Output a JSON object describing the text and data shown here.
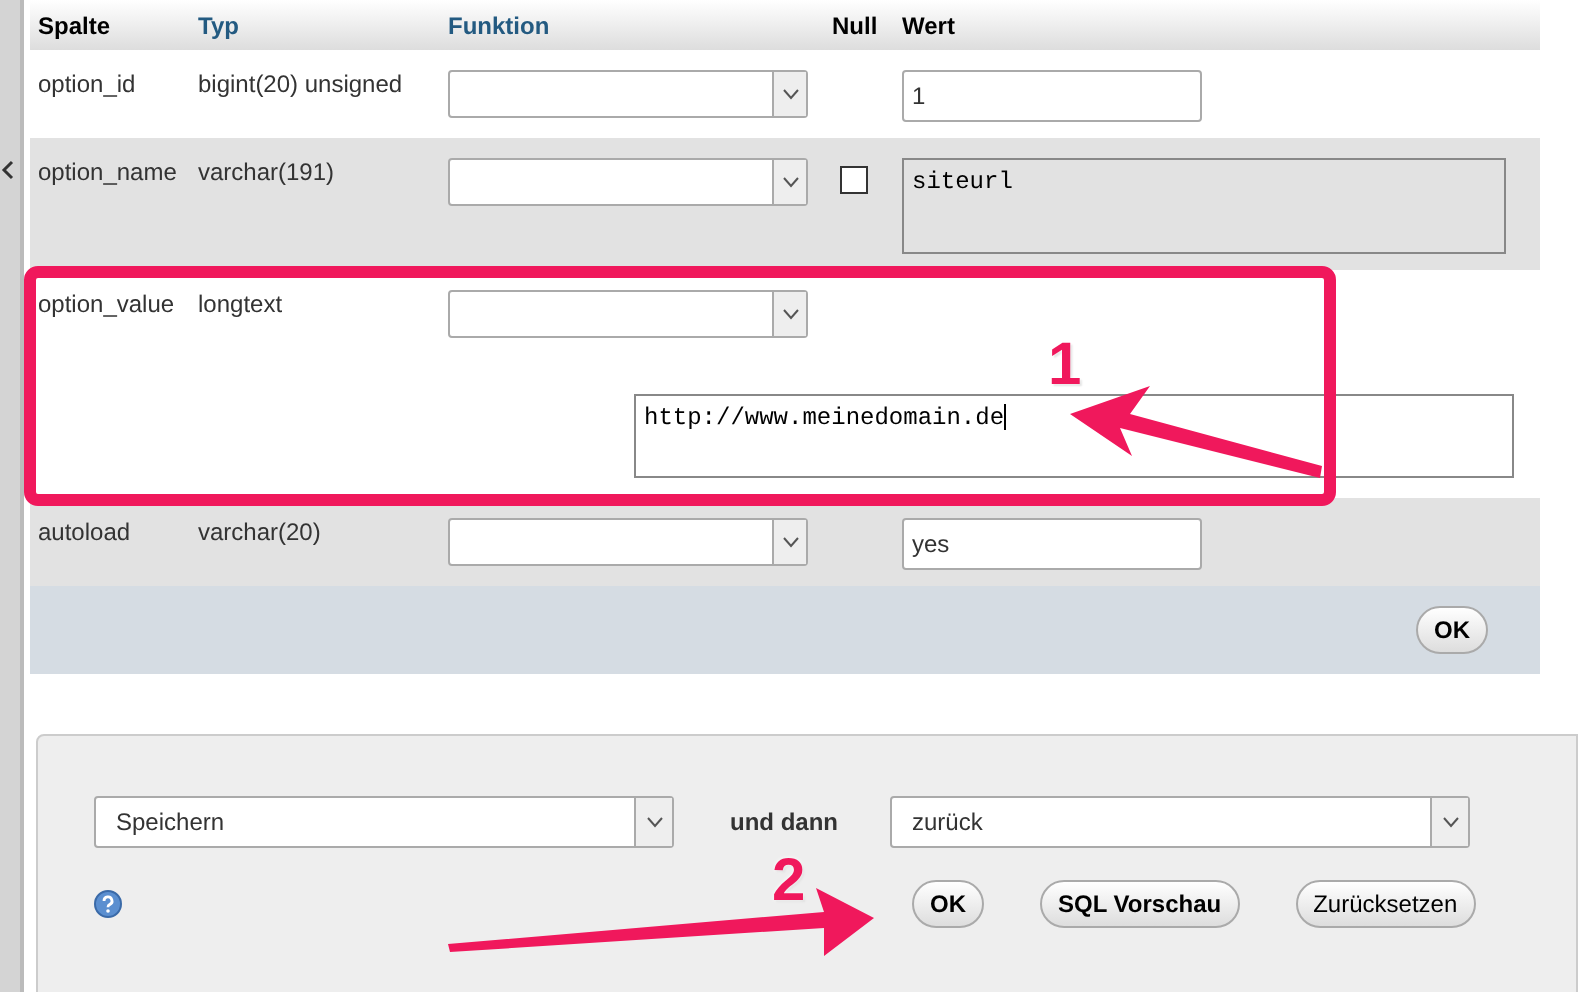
{
  "table": {
    "columns": [
      "Spalte",
      "Typ",
      "Funktion",
      "Null",
      "Wert"
    ],
    "rows": [
      {
        "name": "option_id",
        "type": "bigint(20) unsigned",
        "null": null,
        "value": {
          "kind": "input",
          "text": "1"
        }
      },
      {
        "name": "option_name",
        "type": "varchar(191)",
        "null": {
          "checked": false
        },
        "value": {
          "kind": "textarea",
          "text": "siteurl"
        }
      },
      {
        "name": "option_value",
        "type": "longtext",
        "null": null,
        "value": {
          "kind": "wide-textarea",
          "text": "http://www.meinedomain.de"
        }
      },
      {
        "name": "autoload",
        "type": "varchar(20)",
        "null": null,
        "value": {
          "kind": "input",
          "text": "yes"
        }
      }
    ],
    "ok_button": "OK"
  },
  "form": {
    "action": "Speichern",
    "then_label": "und dann",
    "after": "zurück",
    "buttons": [
      "OK",
      "SQL Vorschau",
      "Zurücksetzen"
    ]
  },
  "annotations": [
    {
      "label": "1"
    },
    {
      "label": "2"
    }
  ]
}
